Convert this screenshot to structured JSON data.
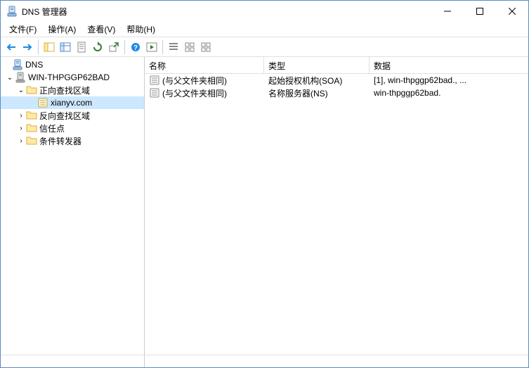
{
  "window": {
    "title": "DNS 管理器"
  },
  "menu": {
    "file": "文件(F)",
    "action": "操作(A)",
    "view": "查看(V)",
    "help": "帮助(H)"
  },
  "tree": {
    "root": "DNS",
    "server": "WIN-THPGGP62BAD",
    "fwd": "正向查找区域",
    "zone": "xianyv.com",
    "rev": "反向查找区域",
    "trust": "信任点",
    "cond": "条件转发器"
  },
  "columns": {
    "name": "名称",
    "type": "类型",
    "data": "数据"
  },
  "records": [
    {
      "name": "(与父文件夹相同)",
      "type": "起始授权机构(SOA)",
      "data": "[1], win-thpggp62bad., ..."
    },
    {
      "name": "(与父文件夹相同)",
      "type": "名称服务器(NS)",
      "data": "win-thpggp62bad."
    }
  ]
}
